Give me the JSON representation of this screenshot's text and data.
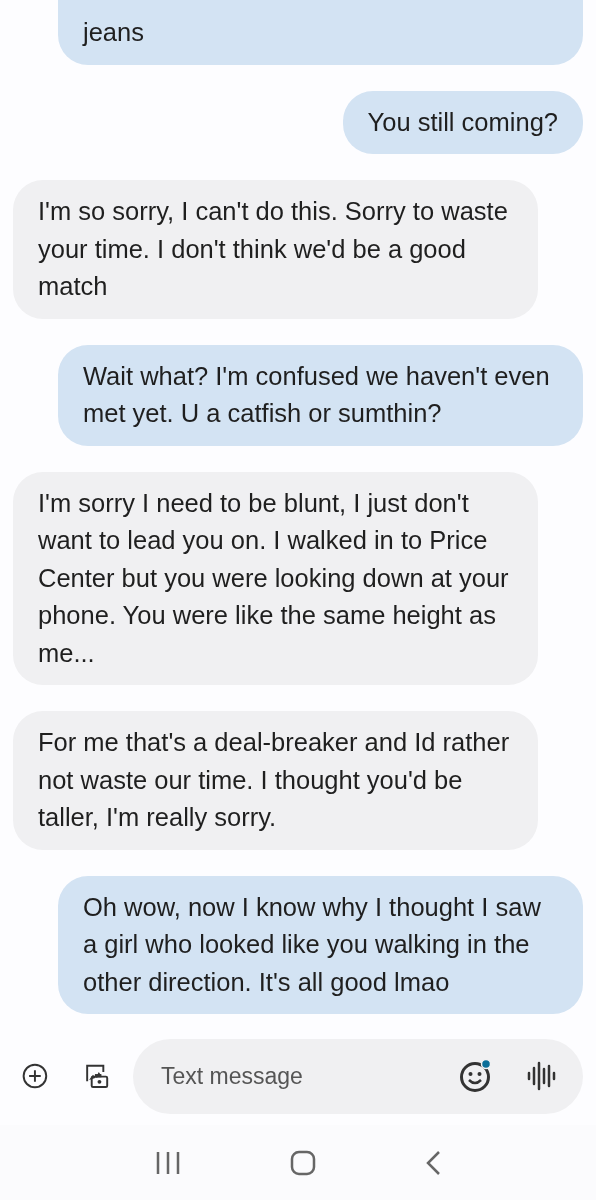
{
  "messages": [
    {
      "sent": true,
      "text": "jeans"
    },
    {
      "sent": true,
      "text": "You still coming?"
    },
    {
      "sent": false,
      "text": "I'm so sorry, I can't do this. Sorry to waste your time. I don't think we'd be a good match"
    },
    {
      "sent": true,
      "text": "Wait what? I'm confused we haven't even met yet. U a catfish or sumthin?"
    },
    {
      "sent": false,
      "text": "I'm sorry I need to be blunt, I just don't want to lead you on. I walked in to Price Center but you were looking down at your phone. You were like the same height as me..."
    },
    {
      "sent": false,
      "text": "For me that's a deal-breaker and Id rather not waste our time. I thought you'd be taller, I'm really sorry."
    },
    {
      "sent": true,
      "text": "Oh wow, now I know why I thought I saw a girl who looked like you walking in the other direction. It's all good lmao"
    }
  ],
  "composer": {
    "placeholder": "Text message"
  }
}
